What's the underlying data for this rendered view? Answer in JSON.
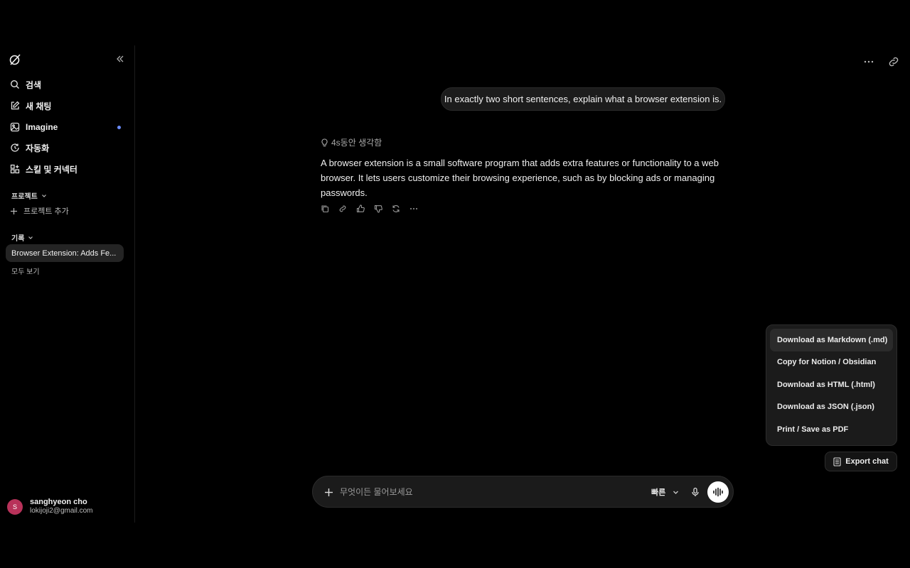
{
  "sidebar": {
    "nav": [
      {
        "label": "검색",
        "icon": "search-icon"
      },
      {
        "label": "새 채팅",
        "icon": "edit-icon"
      },
      {
        "label": "Imagine",
        "icon": "image-icon"
      },
      {
        "label": "자동화",
        "icon": "automation-icon"
      },
      {
        "label": "스킬 및 커넥터",
        "icon": "grid-plus-icon"
      }
    ],
    "projects_label": "프로젝트",
    "add_project_label": "프로젝트 추가",
    "history_label": "기록",
    "history_items": [
      "Browser Extension: Adds Fe..."
    ],
    "see_all_label": "모두 보기",
    "user": {
      "initial": "S",
      "name": "sanghyeon cho",
      "email": "lokijoji2@gmail.com"
    }
  },
  "chat": {
    "user_message": "In exactly two short sentences, explain what a browser extension is.",
    "thought_label": "4s동안 생각함",
    "assistant_message": "A browser extension is a small software program that adds extra features or functionality to a web browser. It lets users customize their browsing experience, such as by blocking ads or managing passwords."
  },
  "export_menu": {
    "items": [
      "Download as Markdown (.md)",
      "Copy for Notion / Obsidian",
      "Download as HTML (.html)",
      "Download as JSON (.json)",
      "Print / Save as PDF"
    ],
    "button_label": "Export chat"
  },
  "composer": {
    "placeholder": "무엇이든 물어보세요",
    "mode_label": "빠른"
  },
  "colors": {
    "background": "#000000",
    "surface": "#1b1b1b",
    "avatar": "#b8325a",
    "dot": "#6b8cff"
  }
}
